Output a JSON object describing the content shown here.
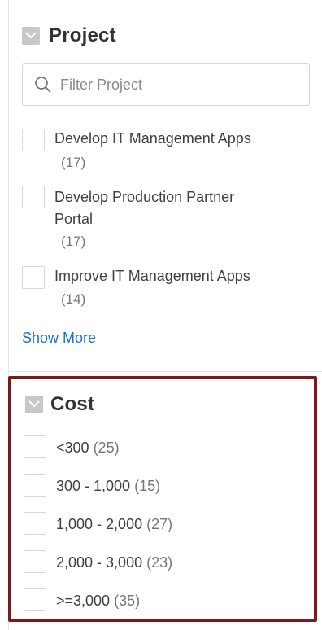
{
  "project_facet": {
    "title": "Project",
    "search_placeholder": "Filter Project",
    "options": [
      {
        "label": "Develop IT Management Apps",
        "count": "(17)"
      },
      {
        "label_line1": "Develop Production Partner",
        "label_line2": "Portal",
        "count": "(17)"
      },
      {
        "label": "Improve IT Management Apps",
        "count": "(14)"
      }
    ],
    "show_more": "Show More"
  },
  "cost_facet": {
    "title": "Cost",
    "options": [
      {
        "label": "<300",
        "count": "(25)"
      },
      {
        "label": "300 - 1,000",
        "count": "(15)"
      },
      {
        "label": "1,000 - 2,000",
        "count": "(27)"
      },
      {
        "label": "2,000 - 3,000",
        "count": "(23)"
      },
      {
        "label": ">=3,000",
        "count": "(35)"
      }
    ]
  },
  "colors": {
    "highlight_border": "#7b1a1e",
    "link": "#1a73c9",
    "collapse_box": "#c8c8c8"
  },
  "icons": [
    "collapse-chevron-icon",
    "search-icon"
  ]
}
